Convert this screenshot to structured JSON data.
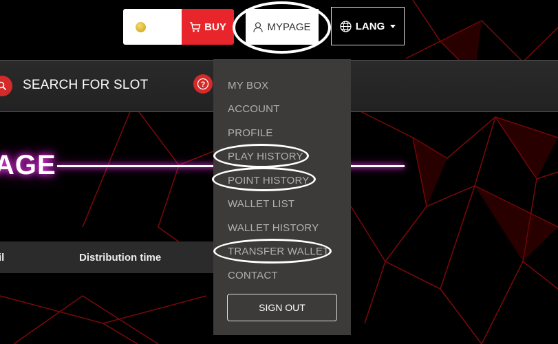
{
  "header": {
    "coin_symbol": "",
    "coin_balance": "",
    "buy_label": "BUY",
    "mypage_label": "MYPAGE",
    "lang_label": "LANG"
  },
  "search": {
    "label": "SEARCH FOR SLOT"
  },
  "page": {
    "heading": "AGE"
  },
  "table": {
    "columns": [
      "il",
      "Distribution time"
    ]
  },
  "mypage_menu": {
    "items": [
      "MY BOX",
      "ACCOUNT",
      "PROFILE",
      "PLAY HISTORY",
      "POINT HISTORY",
      "WALLET LIST",
      "WALLET HISTORY",
      "TRANSFER WALLET",
      "CONTACT"
    ],
    "signout_label": "SIGN OUT"
  },
  "colors": {
    "accent_red": "#e8252a",
    "menu_bg": "#3c3b3a",
    "menu_text": "#b3b1ad",
    "glow": "#ff3cff"
  }
}
